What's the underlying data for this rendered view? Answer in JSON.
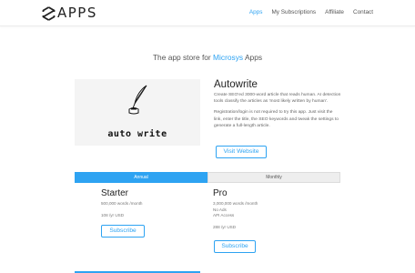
{
  "header": {
    "logo_text": "APPS",
    "nav": [
      {
        "label": "Apps",
        "active": true
      },
      {
        "label": "My Subscriptions",
        "active": false
      },
      {
        "label": "Affiliate",
        "active": false
      },
      {
        "label": "Contact",
        "active": false
      }
    ]
  },
  "tagline": {
    "prefix": "The app store for ",
    "brand": "Microsys",
    "suffix": " Apps"
  },
  "product": {
    "image_caption": "auto write",
    "title": "Autowrite",
    "description": [
      "Create SEO'ed 3000-word article that reads human. AI detection tools classify the articles as 'most likely written by human'.",
      "Registration/login is not required to try this app. Just visit the link, enter the title, the SEO keywords and tweak the settings to generate a full-length article."
    ],
    "visit_label": "Visit Website"
  },
  "tabs": [
    {
      "label": "Annual",
      "active": true
    },
    {
      "label": "Monthly",
      "active": false
    }
  ],
  "plans": {
    "starter": {
      "name": "Starter",
      "words": "500,000 words /month",
      "price": "108 /yr USD",
      "subscribe_label": "Subscribe"
    },
    "pro": {
      "name": "Pro",
      "words": "3,000,000 words /month",
      "feature_1": "No Ads",
      "feature_2": "API Access",
      "price": "288 /yr USD",
      "subscribe_label": "Subscribe"
    }
  },
  "colors": {
    "accent": "#2ea3f2",
    "tab_inactive": "#eeeeee",
    "image_bg": "#f4f4f4"
  }
}
